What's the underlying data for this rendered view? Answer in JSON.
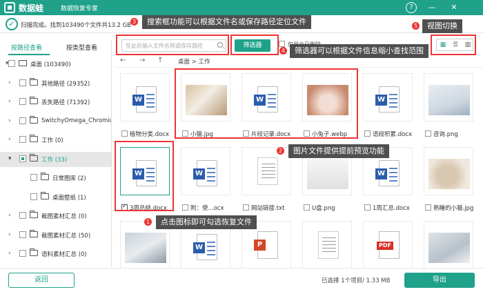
{
  "titlebar": {
    "app_name": "数据蛙",
    "app_sub": "数据恢复专家",
    "help": "?",
    "minimize": "—",
    "close": "✕"
  },
  "status": {
    "text": "扫描完成。找到103490个文件共13.2 GB"
  },
  "annotations": [
    {
      "num": "3",
      "text": "搜索框功能可以根据文件名或保存路径定位文件"
    },
    {
      "num": "5",
      "text": "视图切换"
    },
    {
      "num": "4",
      "text": "筛选器可以根据文件信息缩小查找范围"
    },
    {
      "num": "2",
      "text": "图片文件提供提前预览功能"
    },
    {
      "num": "1",
      "text": "点击图标即可勾选恢复文件"
    }
  ],
  "sidebar": {
    "tab_path": "按路径查看",
    "tab_type": "按类型查看",
    "items": [
      {
        "label": "桌面 (103490)",
        "level": 0,
        "arrow": "▾",
        "icon": "monitor-icon"
      },
      {
        "label": "其他路径 (29352)",
        "level": 1,
        "arrow": "›",
        "icon": "folder-icon"
      },
      {
        "label": "丢失路径 (71392)",
        "level": 1,
        "arrow": "›",
        "icon": "folder-icon"
      },
      {
        "label": "SwitchyOmega_Chromium",
        "level": 1,
        "arrow": "›",
        "icon": "folder-icon"
      },
      {
        "label": "工作 (0)",
        "level": 1,
        "arrow": "›",
        "icon": "folder-icon"
      },
      {
        "label": "工作 (33)",
        "level": 1,
        "arrow": "▾",
        "icon": "folder-icon",
        "selected": true
      },
      {
        "label": "日常图库 (2)",
        "level": 2,
        "arrow": "",
        "icon": "folder-icon"
      },
      {
        "label": "桌面壁纸 (1)",
        "level": 2,
        "arrow": "",
        "icon": "folder-icon"
      },
      {
        "label": "截图素材汇总 (0)",
        "level": 1,
        "arrow": "›",
        "icon": "folder-icon"
      },
      {
        "label": "截图素材汇总 (50)",
        "level": 1,
        "arrow": "›",
        "icon": "folder-icon"
      },
      {
        "label": "语料素材汇总 (0)",
        "level": 1,
        "arrow": "›",
        "icon": "folder-icon"
      }
    ]
  },
  "toolbar": {
    "search_placeholder": "在此处输入文件名称或保存路径",
    "filter_label": "筛选器",
    "only_label": "仅显示已删除",
    "views": [
      "▦",
      "☰",
      "▥"
    ]
  },
  "nav": {
    "back": "←",
    "forward": "→",
    "up": "↑",
    "breadcrumb": "桌面 > 工作"
  },
  "files": [
    {
      "name": "植物分类.docx",
      "kind": "word"
    },
    {
      "name": "小猫.jpg",
      "kind": "image-cat"
    },
    {
      "name": "片段记录.docx",
      "kind": "word"
    },
    {
      "name": "小兔子.webp",
      "kind": "image-rabbit"
    },
    {
      "name": "语段积累.docx",
      "kind": "word"
    },
    {
      "name": "咨询.png",
      "kind": "image-office"
    },
    {
      "name": "3周总结.docx",
      "kind": "word",
      "checked": true
    },
    {
      "name": "附：使...ocx",
      "kind": "word"
    },
    {
      "name": "网站链接.txt",
      "kind": "txt"
    },
    {
      "name": "U盘.png",
      "kind": "image-usb"
    },
    {
      "name": "1周汇总.docx",
      "kind": "word"
    },
    {
      "name": "熟睡的小猫.jpg",
      "kind": "image-cat2"
    },
    {
      "name": "",
      "kind": "image-laptop"
    },
    {
      "name": "",
      "kind": "word"
    },
    {
      "name": "",
      "kind": "ppt"
    },
    {
      "name": "",
      "kind": "txt"
    },
    {
      "name": "",
      "kind": "pdf"
    },
    {
      "name": "",
      "kind": "image-laptop2"
    }
  ],
  "icons": {
    "word_letter": "W",
    "ppt_letter": "P",
    "pdf_label": "PDF"
  },
  "footer": {
    "back_label": "返回",
    "selection": "已选择 1个项目/ 1.33 MB",
    "export_label": "导出"
  },
  "colors": {
    "brand": "#1fa18a",
    "annot_red": "#e33"
  }
}
